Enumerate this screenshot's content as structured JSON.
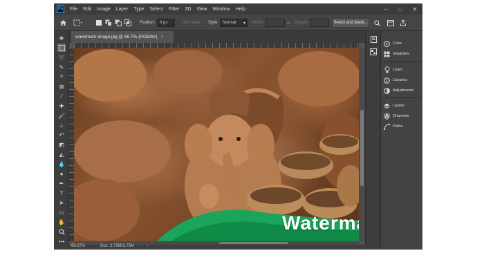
{
  "menubar": {
    "logo": "Ps",
    "items": [
      "File",
      "Edit",
      "Image",
      "Layer",
      "Type",
      "Select",
      "Filter",
      "3D",
      "View",
      "Window",
      "Help"
    ],
    "window_controls": [
      "–",
      "□",
      "✕"
    ]
  },
  "options_bar": {
    "feather_label": "Feather:",
    "feather_value": "0 px",
    "anti_alias_label": "Anti-alias",
    "style_label": "Style:",
    "style_value": "Normal",
    "width_label": "Width:",
    "height_label": "Height:",
    "select_mask_label": "Select and Mask..."
  },
  "document_tab": {
    "title": "watermark-image.jpg @ 66.7% (RGB/8#)",
    "close": "×"
  },
  "canvas": {
    "watermark_text": "Watermark",
    "watermark_color": "#ffffff"
  },
  "status_bar": {
    "zoom": "66.67%",
    "doc_info": "Doc: 2.75M/2.75M",
    "arrow": "›"
  },
  "panels": [
    {
      "label": "Color",
      "icon": "color-wheel-icon"
    },
    {
      "label": "Swatches",
      "icon": "swatches-icon"
    },
    {
      "label": "Learn",
      "icon": "lightbulb-icon"
    },
    {
      "label": "Libraries",
      "icon": "libraries-icon"
    },
    {
      "label": "Adjustments",
      "icon": "adjustments-icon"
    },
    {
      "label": "Layers",
      "icon": "layers-icon"
    },
    {
      "label": "Channels",
      "icon": "channels-icon"
    },
    {
      "label": "Paths",
      "icon": "paths-icon"
    }
  ],
  "colors": {
    "app_bg": "#535353",
    "panel_bg": "#434343",
    "accent": "#31a8ff"
  }
}
